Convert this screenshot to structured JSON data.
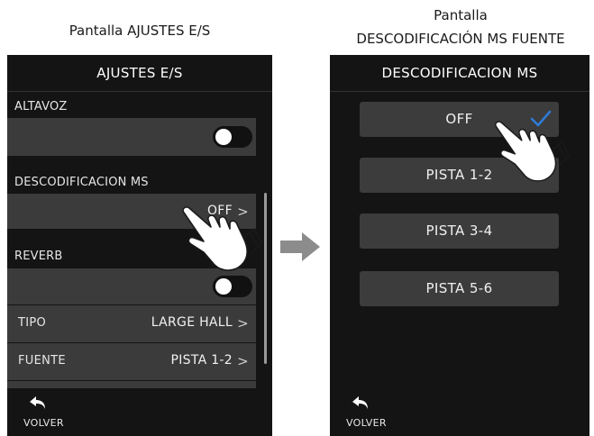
{
  "left": {
    "caption": "Pantalla AJUSTES E/S",
    "title": "AJUSTES E/S",
    "sections": {
      "speaker": "ALTAVOZ",
      "ms_decode": "DESCODIFICACION MS",
      "reverb": "REVERB"
    },
    "ms_decode_value": "OFF",
    "reverb_rows": [
      {
        "label": "TIPO",
        "value": "LARGE HALL"
      },
      {
        "label": "FUENTE",
        "value": "PISTA 1-2"
      }
    ],
    "back_label": "VOLVER"
  },
  "right": {
    "caption_line1": "Pantalla",
    "caption_line2": "DESCODIFICACIÓN MS FUENTE",
    "title": "DESCODIFICACION MS",
    "options": [
      "OFF",
      "PISTA 1-2",
      "PISTA 3-4",
      "PISTA 5-6"
    ],
    "selected_option": "OFF",
    "back_label": "VOLVER"
  },
  "chevron": ">",
  "colors": {
    "screen_bg": "#141414",
    "row_bg": "#3b3b3b",
    "check": "#2f7bd6",
    "arrow": "#8c8c8c"
  }
}
